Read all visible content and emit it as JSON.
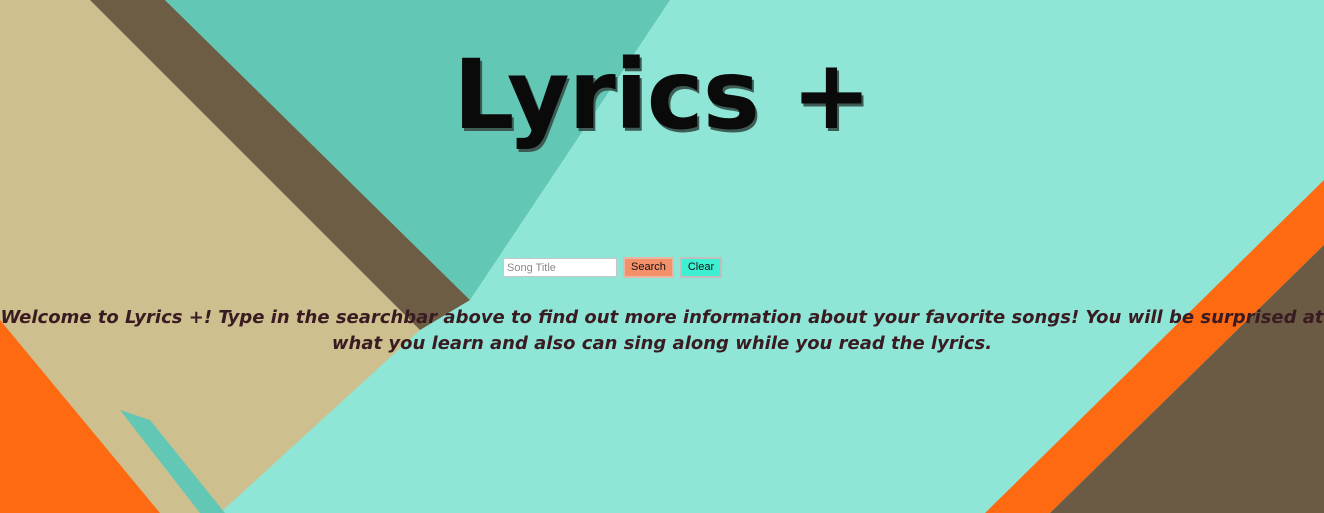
{
  "page": {
    "title": "Lyrics +"
  },
  "search": {
    "placeholder": "Song Title",
    "value": "",
    "search_label": "Search",
    "clear_label": "Clear"
  },
  "welcome": {
    "text": "Welcome to Lyrics +! Type in the searchbar above to find out more information about your favorite songs! You will be surprised at what you learn and also can sing along while you read the lyrics."
  },
  "colors": {
    "teal_light": "#8fe6d6",
    "teal_dark": "#5ec4b2",
    "khaki": "#cdbf8e",
    "brown": "#6b5a44",
    "orange": "#fe6a12",
    "search_button": "#f4916a",
    "clear_button": "#3df0d2",
    "welcome_text": "#3a1b22"
  }
}
